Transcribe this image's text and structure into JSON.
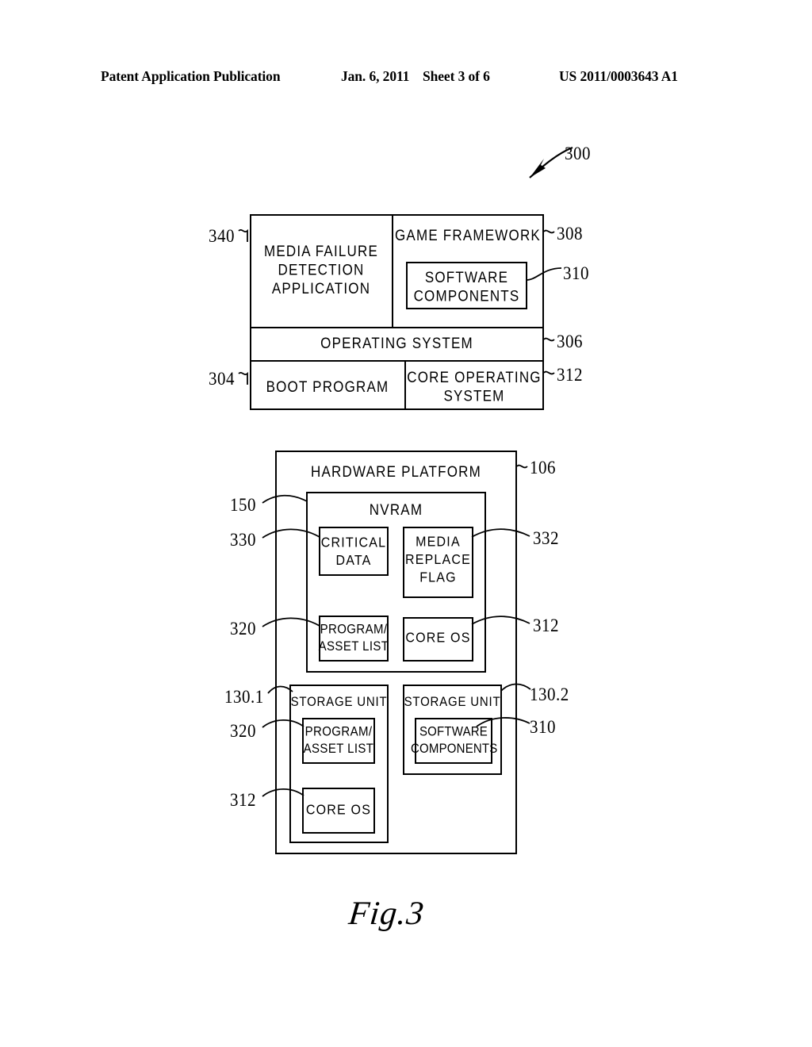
{
  "header": {
    "publication": "Patent Application Publication",
    "date": "Jan. 6, 2011",
    "sheet": "Sheet 3 of 6",
    "patent_number": "US 2011/0003643 A1"
  },
  "figure": {
    "caption": "Fig.3",
    "system_ref": "300"
  },
  "software_stack": {
    "media_failure_detection": {
      "label": "MEDIA FAILURE\nDETECTION\nAPPLICATION",
      "ref": "340"
    },
    "game_framework": {
      "label": "GAME FRAMEWORK",
      "ref": "308"
    },
    "software_components": {
      "label": "SOFTWARE\nCOMPONENTS",
      "ref": "310"
    },
    "operating_system": {
      "label": "OPERATING SYSTEM",
      "ref": "306"
    },
    "boot_program": {
      "label": "BOOT PROGRAM",
      "ref": "304"
    },
    "core_operating_system": {
      "label": "CORE OPERATING\nSYSTEM",
      "ref": "312"
    }
  },
  "hardware_platform": {
    "label": "HARDWARE PLATFORM",
    "ref": "106",
    "nvram": {
      "label": "NVRAM",
      "ref": "150",
      "critical_data": {
        "label": "CRITICAL\nDATA",
        "ref": "330"
      },
      "media_replace_flag": {
        "label": "MEDIA\nREPLACE\nFLAG",
        "ref": "332"
      },
      "program_asset_list": {
        "label": "PROGRAM/\nASSET LIST",
        "ref": "320"
      },
      "core_os": {
        "label": "CORE OS",
        "ref": "312"
      }
    },
    "storage_unit_1": {
      "label": "STORAGE UNIT",
      "ref": "130.1",
      "program_asset_list": {
        "label": "PROGRAM/\nASSET LIST",
        "ref": "320"
      },
      "core_os": {
        "label": "CORE OS",
        "ref": "312"
      }
    },
    "storage_unit_2": {
      "label": "STORAGE UNIT",
      "ref": "130.2",
      "software_components": {
        "label": "SOFTWARE\nCOMPONENTS",
        "ref": "310"
      }
    }
  }
}
